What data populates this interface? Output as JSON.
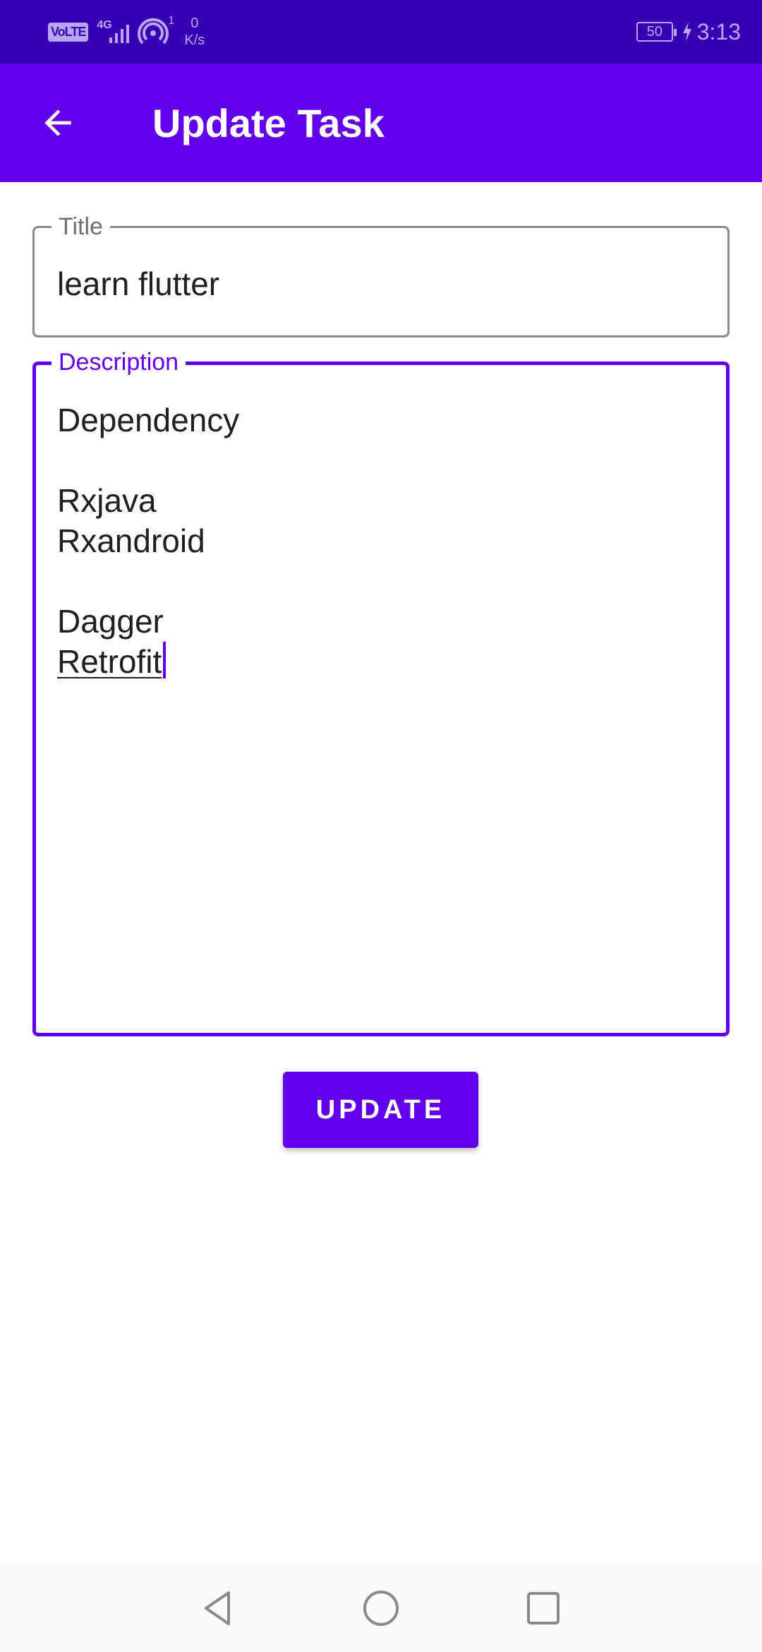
{
  "status_bar": {
    "volte": "VoLTE",
    "network": "4G",
    "hotspot_count": "1",
    "speed_value": "0",
    "speed_unit": "K/s",
    "battery": "50",
    "time": "3:13"
  },
  "app_bar": {
    "back_icon": "arrow-back-icon",
    "title": "Update Task"
  },
  "form": {
    "title_label": "Title",
    "title_value": "learn flutter",
    "description_label": "Description",
    "description_lines": [
      "Dependency",
      "",
      "Rxjava",
      "Rxandroid",
      "",
      "Dagger",
      "Retrofit"
    ]
  },
  "update_button": "UPDATE",
  "nav": {
    "back": "nav-back-icon",
    "home": "nav-home-icon",
    "recent": "nav-recent-icon"
  },
  "colors": {
    "primary": "#6200ee",
    "primary_dark": "#3700b3",
    "on_primary": "#ffffff",
    "text": "#1f1f1f",
    "outline": "#8a8a8a"
  }
}
